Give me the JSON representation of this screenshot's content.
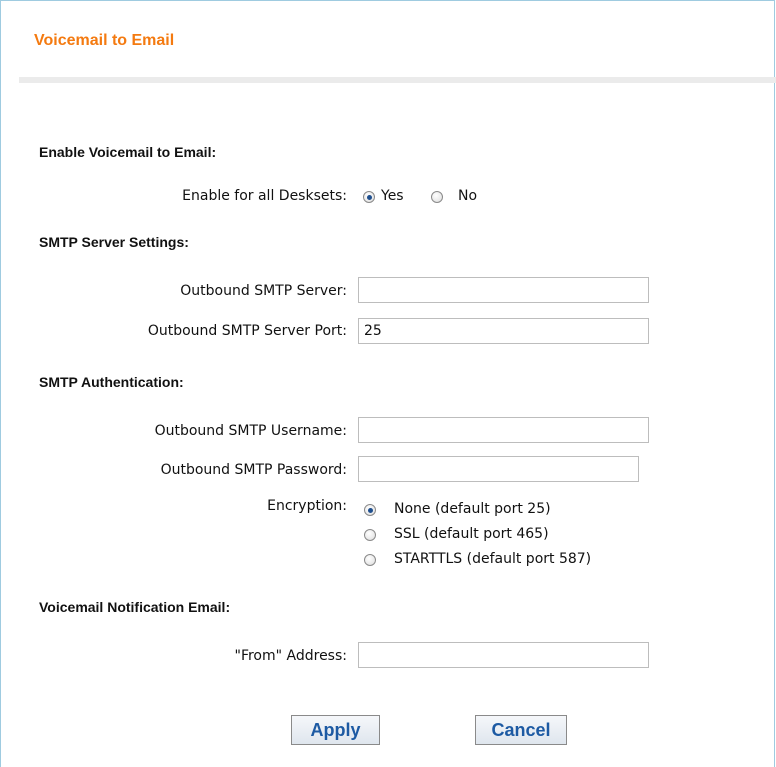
{
  "page": {
    "title": "Voicemail to Email"
  },
  "enable": {
    "heading": "Enable Voicemail to Email:",
    "label": "Enable for all Desksets:",
    "yes_label": "Yes",
    "no_label": "No",
    "selected": "Yes"
  },
  "smtp_server": {
    "heading": "SMTP Server Settings:",
    "server_label": "Outbound SMTP Server:",
    "server_value": "",
    "port_label": "Outbound SMTP Server Port:",
    "port_value": "25"
  },
  "smtp_auth": {
    "heading": "SMTP Authentication:",
    "username_label": "Outbound SMTP Username:",
    "username_value": "",
    "password_label": "Outbound SMTP Password:",
    "password_value": "",
    "encryption_label": "Encryption:",
    "options": [
      {
        "label": "None (default port 25)",
        "selected": true
      },
      {
        "label": "SSL (default port 465)",
        "selected": false
      },
      {
        "label": "STARTTLS (default port 587)",
        "selected": false
      }
    ]
  },
  "notification": {
    "heading": "Voicemail Notification Email:",
    "from_label": "\"From\" Address:",
    "from_value": ""
  },
  "buttons": {
    "apply": "Apply",
    "cancel": "Cancel"
  }
}
